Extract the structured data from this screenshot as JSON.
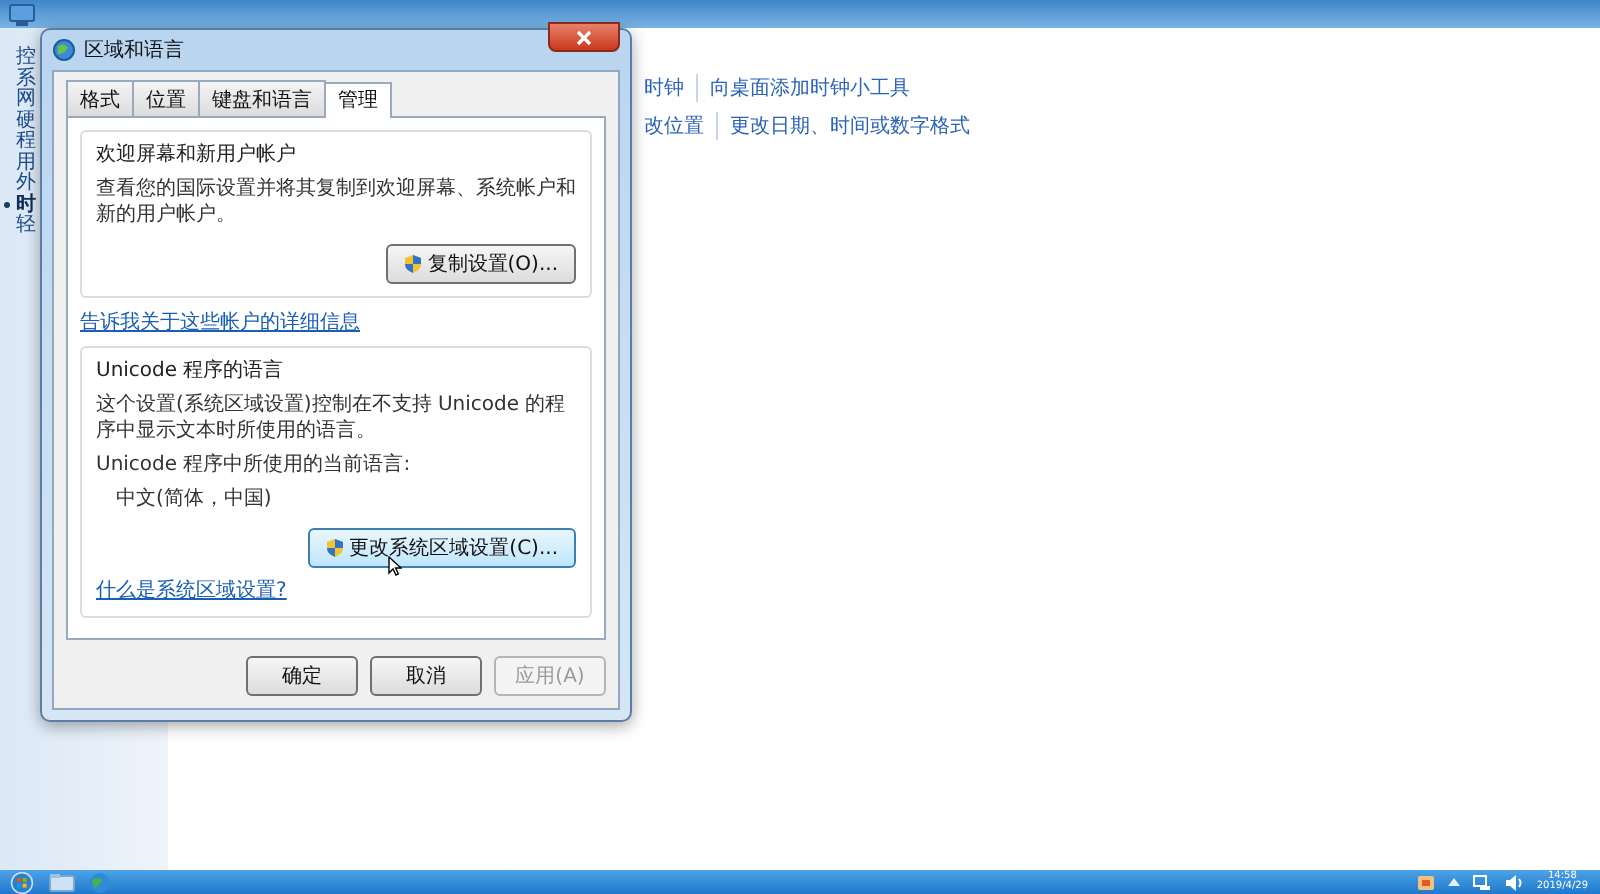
{
  "background_window": {
    "sidebar_items": [
      {
        "label": "控",
        "selected": false
      },
      {
        "label": "系",
        "selected": false
      },
      {
        "label": "网",
        "selected": false
      },
      {
        "label": "硬",
        "selected": false
      },
      {
        "label": "程",
        "selected": false
      },
      {
        "label": "用",
        "selected": false
      },
      {
        "label": "外",
        "selected": false
      },
      {
        "label": "时",
        "selected": true
      },
      {
        "label": "轻",
        "selected": false
      }
    ],
    "link_rows": [
      [
        "时钟",
        "向桌面添加时钟小工具"
      ],
      [
        "改位置",
        "更改日期、时间或数字格式"
      ]
    ]
  },
  "dialog": {
    "title": "区域和语言",
    "tabs": [
      {
        "label": "格式",
        "selected": false
      },
      {
        "label": "位置",
        "selected": false
      },
      {
        "label": "键盘和语言",
        "selected": false
      },
      {
        "label": "管理",
        "selected": true
      }
    ],
    "welcome": {
      "title": "欢迎屏幕和新用户帐户",
      "text": "查看您的国际设置并将其复制到欢迎屏幕、系统帐户和新的用户帐户。",
      "button": {
        "label": "复制设置(O)...",
        "hovered": false
      },
      "link": "告诉我关于这些帐户的详细信息"
    },
    "unicode": {
      "title": "Unicode 程序的语言",
      "text": "这个设置(系统区域设置)控制在不支持 Unicode 的程序中显示文本时所使用的语言。",
      "current_label": "Unicode 程序中所使用的当前语言:",
      "current_value": "中文(简体，中国)",
      "button": {
        "label": "更改系统区域设置(C)...",
        "hovered": true
      },
      "link": "什么是系统区域设置?"
    },
    "buttons": [
      {
        "label": "确定",
        "disabled": false
      },
      {
        "label": "取消",
        "disabled": false
      },
      {
        "label": "应用(A)",
        "disabled": true
      }
    ]
  },
  "taskbar": {
    "time": "14:58",
    "date": "2019/4/29"
  }
}
